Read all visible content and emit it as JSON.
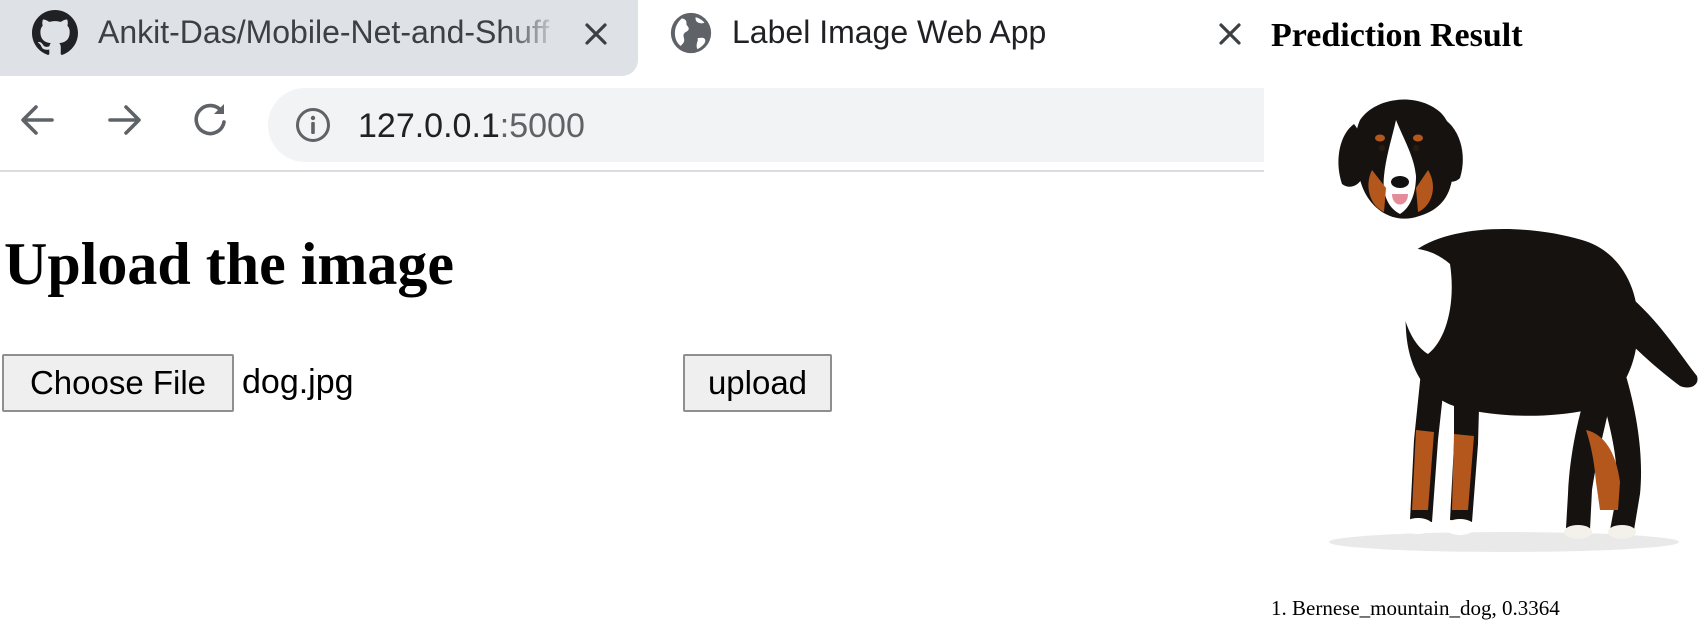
{
  "browser": {
    "tabs": [
      {
        "title": "Ankit-Das/Mobile-Net-and-Shuff",
        "icon": "github-icon"
      },
      {
        "title": "Label Image Web App",
        "icon": "globe-icon"
      }
    ],
    "address_bar": {
      "icon": "info-icon",
      "host": "127.0.0.1",
      "port": ":5000"
    },
    "nav_icons": [
      "back-arrow-icon",
      "forward-arrow-icon",
      "reload-icon"
    ]
  },
  "page": {
    "heading": "Upload the image",
    "choose_file_label": "Choose File",
    "selected_file": "dog.jpg",
    "upload_label": "upload"
  },
  "result": {
    "title": "Prediction Result",
    "image_subject": "dog",
    "prediction": "1. Bernese_mountain_dog, 0.3364"
  },
  "colors": {
    "inactive_tab": "#dee1e6",
    "omnibox": "#f1f3f4",
    "button_bg": "#efefef",
    "dog_black": "#16120f",
    "dog_tan": "#b4571d"
  }
}
